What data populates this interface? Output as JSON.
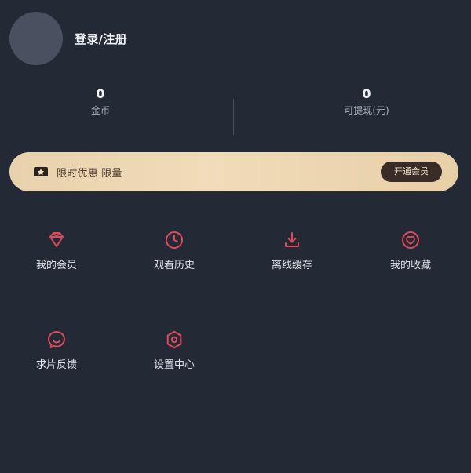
{
  "profile": {
    "login_label": "登录/注册"
  },
  "stats": {
    "coins": {
      "value": "0",
      "label": "金币"
    },
    "withdrawable": {
      "value": "0",
      "label": "可提现(元)"
    }
  },
  "vip_banner": {
    "icon": "ticket-star-icon",
    "text": "限时优惠 限量",
    "button_label": "开通会员",
    "colors": {
      "gradient_start": "#e8d2ad",
      "gradient_end": "#e7cfa7",
      "button_bg": "#3a2c27",
      "button_text": "#f2e3cc"
    }
  },
  "grid": {
    "accent_color": "#e04a5a",
    "items": [
      {
        "label": "我的会员",
        "icon": "gem-icon"
      },
      {
        "label": "观看历史",
        "icon": "clock-icon"
      },
      {
        "label": "离线缓存",
        "icon": "download-icon"
      },
      {
        "label": "我的收藏",
        "icon": "heart-icon"
      },
      {
        "label": "求片反馈",
        "icon": "chat-bubble-icon"
      },
      {
        "label": "设置中心",
        "icon": "settings-hex-icon"
      }
    ]
  }
}
